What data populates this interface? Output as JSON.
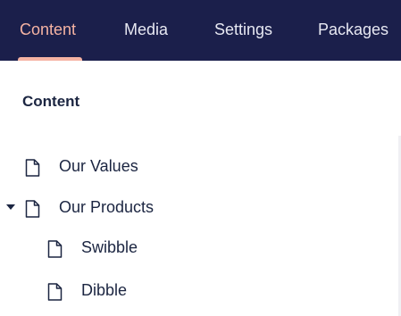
{
  "header": {
    "tabs": [
      {
        "label": "Content",
        "active": true
      },
      {
        "label": "Media",
        "active": false
      },
      {
        "label": "Settings",
        "active": false
      },
      {
        "label": "Packages",
        "active": false
      }
    ]
  },
  "tree": {
    "title": "Content",
    "items": [
      {
        "label": "Our Values",
        "icon": "document-icon",
        "expanded": false
      },
      {
        "label": "Our Products",
        "icon": "document-icon",
        "expanded": true
      },
      {
        "label": "Swibble",
        "icon": "document-icon"
      },
      {
        "label": "Dibble",
        "icon": "document-icon"
      }
    ]
  },
  "colors": {
    "header_bg": "#1b1f4b",
    "active_tab": "#f5b3a3",
    "text": "#1b2541"
  }
}
